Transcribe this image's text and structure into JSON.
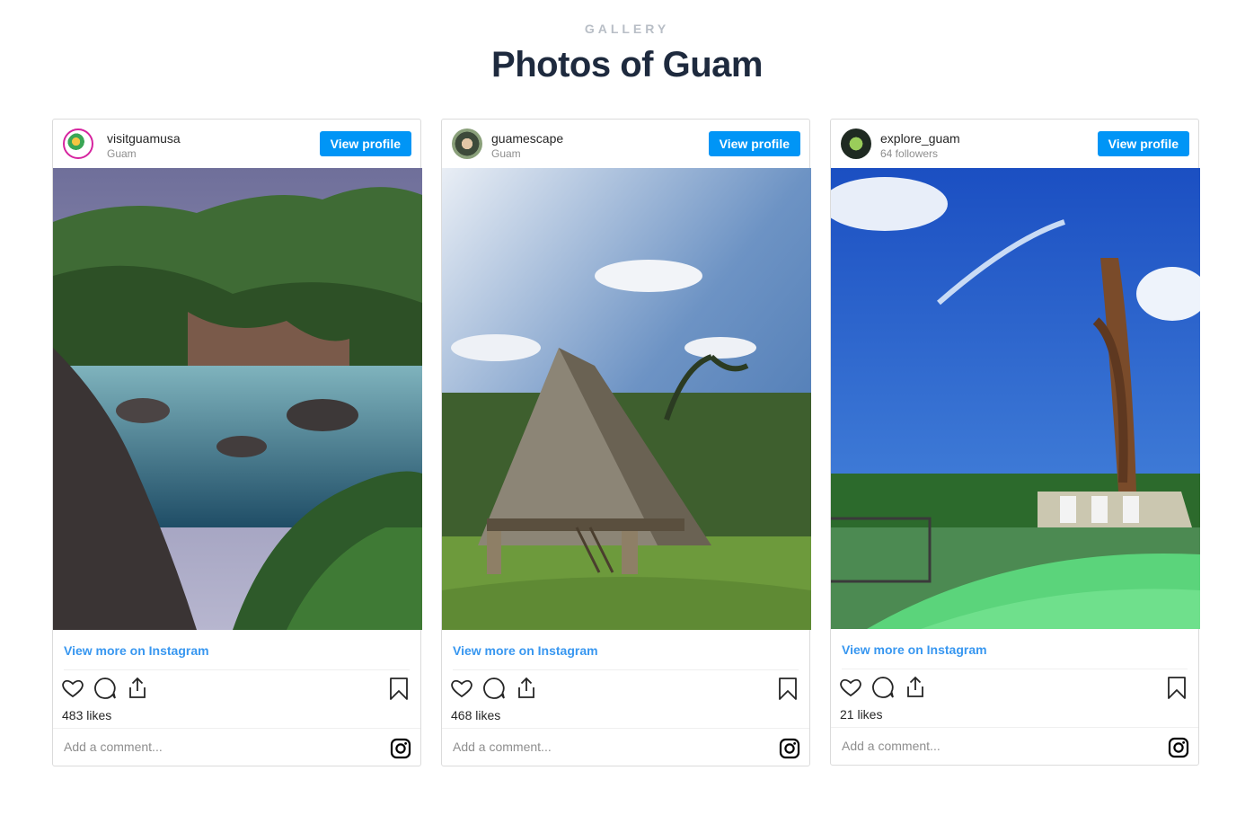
{
  "header": {
    "label": "GALLERY",
    "title": "Photos of Guam"
  },
  "common": {
    "view_profile": "View profile",
    "view_more": "View more on Instagram",
    "comment_placeholder": "Add a comment..."
  },
  "cards": [
    {
      "username": "visitguamusa",
      "subline": "Guam",
      "likes": "483 likes"
    },
    {
      "username": "guamescape",
      "subline": "Guam",
      "likes": "468 likes"
    },
    {
      "username": "explore_guam",
      "subline": "64 followers",
      "likes": "21 likes"
    }
  ],
  "colors": {
    "accent": "#0095f6",
    "link": "#3897f0",
    "title": "#1e2a3e"
  }
}
